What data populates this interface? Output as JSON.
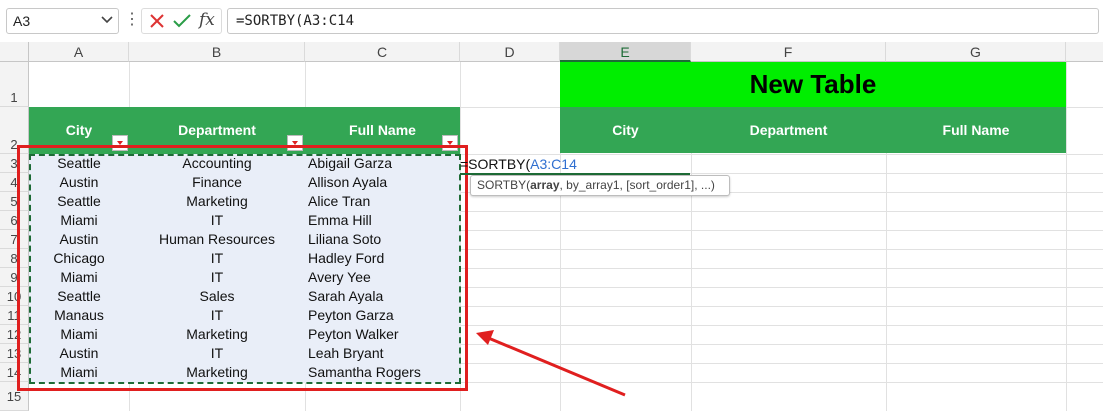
{
  "formula_bar": {
    "name_box": "A3",
    "fx_label": "fx",
    "formula": "=SORTBY(A3:C14"
  },
  "columns": [
    "A",
    "B",
    "C",
    "D",
    "E",
    "F",
    "G"
  ],
  "rows": [
    "1",
    "2",
    "3",
    "4",
    "5",
    "6",
    "7",
    "8",
    "9",
    "10",
    "11",
    "12",
    "13",
    "14",
    "15"
  ],
  "source_table": {
    "headers": [
      "City",
      "Department",
      "Full Name"
    ],
    "rows": [
      [
        "Seattle",
        "Accounting",
        "Abigail Garza"
      ],
      [
        "Austin",
        "Finance",
        "Allison Ayala"
      ],
      [
        "Seattle",
        "Marketing",
        "Alice Tran"
      ],
      [
        "Miami",
        "IT",
        "Emma Hill"
      ],
      [
        "Austin",
        "Human Resources",
        "Liliana Soto"
      ],
      [
        "Chicago",
        "IT",
        "Hadley Ford"
      ],
      [
        "Miami",
        "IT",
        "Avery Yee"
      ],
      [
        "Seattle",
        "Sales",
        "Sarah Ayala"
      ],
      [
        "Manaus",
        "IT",
        "Peyton Garza"
      ],
      [
        "Miami",
        "Marketing",
        "Peyton Walker"
      ],
      [
        "Austin",
        "IT",
        "Leah Bryant"
      ],
      [
        "Miami",
        "Marketing",
        "Samantha Rogers"
      ]
    ]
  },
  "new_table": {
    "title": "New Table",
    "headers": [
      "City",
      "Department",
      "Full Name"
    ]
  },
  "editing_cell": {
    "prefix": "=SORTBY(",
    "range": "A3:C14"
  },
  "tooltip": {
    "func": "SORTBY(",
    "arg_bold": "array",
    "rest": ", by_array1, [sort_order1], ...)"
  },
  "colors": {
    "header_green": "#33a654",
    "title_green": "#00ee00",
    "highlight_red": "#e01f1f",
    "range_blue": "#2f6fd0"
  }
}
